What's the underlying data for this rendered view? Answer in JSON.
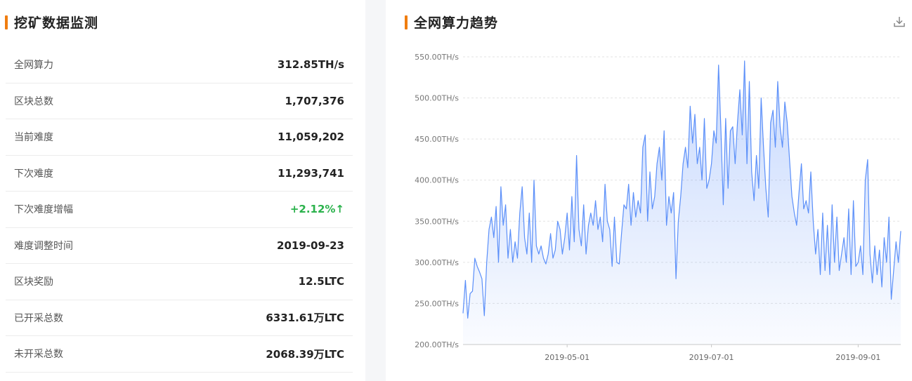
{
  "left": {
    "title": "挖矿数据监测",
    "rows": [
      {
        "label": "全网算力",
        "value": "312.85TH/s"
      },
      {
        "label": "区块总数",
        "value": "1,707,376"
      },
      {
        "label": "当前难度",
        "value": "11,059,202"
      },
      {
        "label": "下次难度",
        "value": "11,293,741"
      },
      {
        "label": "下次难度增幅",
        "value": "+2.12%↑",
        "status": "up"
      },
      {
        "label": "难度调整时间",
        "value": "2019-09-23"
      },
      {
        "label": "区块奖励",
        "value": "12.5LTC"
      },
      {
        "label": "已开采总数",
        "value": "6331.61万LTC"
      },
      {
        "label": "未开采总数",
        "value": "2068.39万LTC"
      }
    ]
  },
  "right": {
    "title": "全网算力趋势",
    "download_icon": "download-icon"
  },
  "colors": {
    "accent": "#f07d0f",
    "line": "#5b8ff9",
    "up": "#2bb24c"
  },
  "chart_data": {
    "type": "area",
    "ylim": [
      200,
      550
    ],
    "yunit": "TH/s",
    "yticks": [
      "200.00TH/s",
      "250.00TH/s",
      "300.00TH/s",
      "350.00TH/s",
      "400.00TH/s",
      "450.00TH/s",
      "500.00TH/s",
      "550.00TH/s"
    ],
    "xticks": [
      "2019-05-01",
      "2019-07-01",
      "2019-09-01"
    ],
    "xrange": [
      "2019-03-18",
      "2019-09-19"
    ],
    "points": [
      [
        "2019-03-18",
        238
      ],
      [
        "2019-03-19",
        278
      ],
      [
        "2019-03-20",
        232
      ],
      [
        "2019-03-21",
        262
      ],
      [
        "2019-03-22",
        265
      ],
      [
        "2019-03-23",
        305
      ],
      [
        "2019-03-24",
        295
      ],
      [
        "2019-03-25",
        288
      ],
      [
        "2019-03-26",
        280
      ],
      [
        "2019-03-27",
        235
      ],
      [
        "2019-03-28",
        300
      ],
      [
        "2019-03-29",
        340
      ],
      [
        "2019-03-30",
        355
      ],
      [
        "2019-03-31",
        330
      ],
      [
        "2019-04-01",
        368
      ],
      [
        "2019-04-02",
        300
      ],
      [
        "2019-04-03",
        392
      ],
      [
        "2019-04-04",
        345
      ],
      [
        "2019-04-05",
        370
      ],
      [
        "2019-04-06",
        305
      ],
      [
        "2019-04-07",
        340
      ],
      [
        "2019-04-08",
        300
      ],
      [
        "2019-04-09",
        325
      ],
      [
        "2019-04-10",
        305
      ],
      [
        "2019-04-11",
        360
      ],
      [
        "2019-04-12",
        392
      ],
      [
        "2019-04-13",
        330
      ],
      [
        "2019-04-14",
        310
      ],
      [
        "2019-04-15",
        360
      ],
      [
        "2019-04-16",
        300
      ],
      [
        "2019-04-17",
        400
      ],
      [
        "2019-04-18",
        320
      ],
      [
        "2019-04-19",
        310
      ],
      [
        "2019-04-20",
        320
      ],
      [
        "2019-04-21",
        305
      ],
      [
        "2019-04-22",
        298
      ],
      [
        "2019-04-23",
        310
      ],
      [
        "2019-04-24",
        335
      ],
      [
        "2019-04-25",
        305
      ],
      [
        "2019-04-26",
        315
      ],
      [
        "2019-04-27",
        350
      ],
      [
        "2019-04-28",
        340
      ],
      [
        "2019-04-29",
        310
      ],
      [
        "2019-04-30",
        330
      ],
      [
        "2019-05-01",
        360
      ],
      [
        "2019-05-02",
        315
      ],
      [
        "2019-05-03",
        380
      ],
      [
        "2019-05-04",
        325
      ],
      [
        "2019-05-05",
        430
      ],
      [
        "2019-05-06",
        340
      ],
      [
        "2019-05-07",
        320
      ],
      [
        "2019-05-08",
        370
      ],
      [
        "2019-05-09",
        310
      ],
      [
        "2019-05-10",
        345
      ],
      [
        "2019-05-11",
        360
      ],
      [
        "2019-05-12",
        345
      ],
      [
        "2019-05-13",
        375
      ],
      [
        "2019-05-14",
        340
      ],
      [
        "2019-05-15",
        355
      ],
      [
        "2019-05-16",
        325
      ],
      [
        "2019-05-17",
        395
      ],
      [
        "2019-05-18",
        350
      ],
      [
        "2019-05-19",
        340
      ],
      [
        "2019-05-20",
        295
      ],
      [
        "2019-05-21",
        355
      ],
      [
        "2019-05-22",
        300
      ],
      [
        "2019-05-23",
        298
      ],
      [
        "2019-05-24",
        335
      ],
      [
        "2019-05-25",
        370
      ],
      [
        "2019-05-26",
        365
      ],
      [
        "2019-05-27",
        395
      ],
      [
        "2019-05-28",
        345
      ],
      [
        "2019-05-29",
        385
      ],
      [
        "2019-05-30",
        355
      ],
      [
        "2019-05-31",
        375
      ],
      [
        "2019-06-01",
        360
      ],
      [
        "2019-06-02",
        440
      ],
      [
        "2019-06-03",
        455
      ],
      [
        "2019-06-04",
        350
      ],
      [
        "2019-06-05",
        410
      ],
      [
        "2019-06-06",
        365
      ],
      [
        "2019-06-07",
        380
      ],
      [
        "2019-06-08",
        420
      ],
      [
        "2019-06-09",
        440
      ],
      [
        "2019-06-10",
        400
      ],
      [
        "2019-06-11",
        460
      ],
      [
        "2019-06-12",
        345
      ],
      [
        "2019-06-13",
        380
      ],
      [
        "2019-06-14",
        360
      ],
      [
        "2019-06-15",
        385
      ],
      [
        "2019-06-16",
        280
      ],
      [
        "2019-06-17",
        350
      ],
      [
        "2019-06-18",
        380
      ],
      [
        "2019-06-19",
        420
      ],
      [
        "2019-06-20",
        440
      ],
      [
        "2019-06-21",
        415
      ],
      [
        "2019-06-22",
        490
      ],
      [
        "2019-06-23",
        445
      ],
      [
        "2019-06-24",
        480
      ],
      [
        "2019-06-25",
        420
      ],
      [
        "2019-06-26",
        440
      ],
      [
        "2019-06-27",
        400
      ],
      [
        "2019-06-28",
        475
      ],
      [
        "2019-06-29",
        390
      ],
      [
        "2019-06-30",
        400
      ],
      [
        "2019-07-01",
        420
      ],
      [
        "2019-07-02",
        460
      ],
      [
        "2019-07-03",
        445
      ],
      [
        "2019-07-04",
        540
      ],
      [
        "2019-07-05",
        460
      ],
      [
        "2019-07-06",
        370
      ],
      [
        "2019-07-07",
        475
      ],
      [
        "2019-07-08",
        390
      ],
      [
        "2019-07-09",
        460
      ],
      [
        "2019-07-10",
        465
      ],
      [
        "2019-07-11",
        420
      ],
      [
        "2019-07-12",
        470
      ],
      [
        "2019-07-13",
        510
      ],
      [
        "2019-07-14",
        455
      ],
      [
        "2019-07-15",
        545
      ],
      [
        "2019-07-16",
        420
      ],
      [
        "2019-07-17",
        520
      ],
      [
        "2019-07-18",
        410
      ],
      [
        "2019-07-19",
        375
      ],
      [
        "2019-07-20",
        430
      ],
      [
        "2019-07-21",
        390
      ],
      [
        "2019-07-22",
        500
      ],
      [
        "2019-07-23",
        440
      ],
      [
        "2019-07-24",
        390
      ],
      [
        "2019-07-25",
        355
      ],
      [
        "2019-07-26",
        470
      ],
      [
        "2019-07-27",
        485
      ],
      [
        "2019-07-28",
        440
      ],
      [
        "2019-07-29",
        520
      ],
      [
        "2019-07-30",
        465
      ],
      [
        "2019-07-31",
        440
      ],
      [
        "2019-08-01",
        495
      ],
      [
        "2019-08-02",
        470
      ],
      [
        "2019-08-03",
        425
      ],
      [
        "2019-08-04",
        380
      ],
      [
        "2019-08-05",
        360
      ],
      [
        "2019-08-06",
        345
      ],
      [
        "2019-08-07",
        385
      ],
      [
        "2019-08-08",
        420
      ],
      [
        "2019-08-09",
        365
      ],
      [
        "2019-08-10",
        375
      ],
      [
        "2019-08-11",
        360
      ],
      [
        "2019-08-12",
        410
      ],
      [
        "2019-08-13",
        350
      ],
      [
        "2019-08-14",
        310
      ],
      [
        "2019-08-15",
        340
      ],
      [
        "2019-08-16",
        285
      ],
      [
        "2019-08-17",
        360
      ],
      [
        "2019-08-18",
        290
      ],
      [
        "2019-08-19",
        345
      ],
      [
        "2019-08-20",
        285
      ],
      [
        "2019-08-21",
        370
      ],
      [
        "2019-08-22",
        300
      ],
      [
        "2019-08-23",
        355
      ],
      [
        "2019-08-24",
        290
      ],
      [
        "2019-08-25",
        310
      ],
      [
        "2019-08-26",
        330
      ],
      [
        "2019-08-27",
        300
      ],
      [
        "2019-08-28",
        365
      ],
      [
        "2019-08-29",
        285
      ],
      [
        "2019-08-30",
        375
      ],
      [
        "2019-08-31",
        295
      ],
      [
        "2019-09-01",
        300
      ],
      [
        "2019-09-02",
        320
      ],
      [
        "2019-09-03",
        285
      ],
      [
        "2019-09-04",
        400
      ],
      [
        "2019-09-05",
        425
      ],
      [
        "2019-09-06",
        310
      ],
      [
        "2019-09-07",
        275
      ],
      [
        "2019-09-08",
        320
      ],
      [
        "2019-09-09",
        285
      ],
      [
        "2019-09-10",
        315
      ],
      [
        "2019-09-11",
        270
      ],
      [
        "2019-09-12",
        330
      ],
      [
        "2019-09-13",
        300
      ],
      [
        "2019-09-14",
        355
      ],
      [
        "2019-09-15",
        255
      ],
      [
        "2019-09-16",
        290
      ],
      [
        "2019-09-17",
        325
      ],
      [
        "2019-09-18",
        300
      ],
      [
        "2019-09-19",
        338
      ]
    ]
  }
}
